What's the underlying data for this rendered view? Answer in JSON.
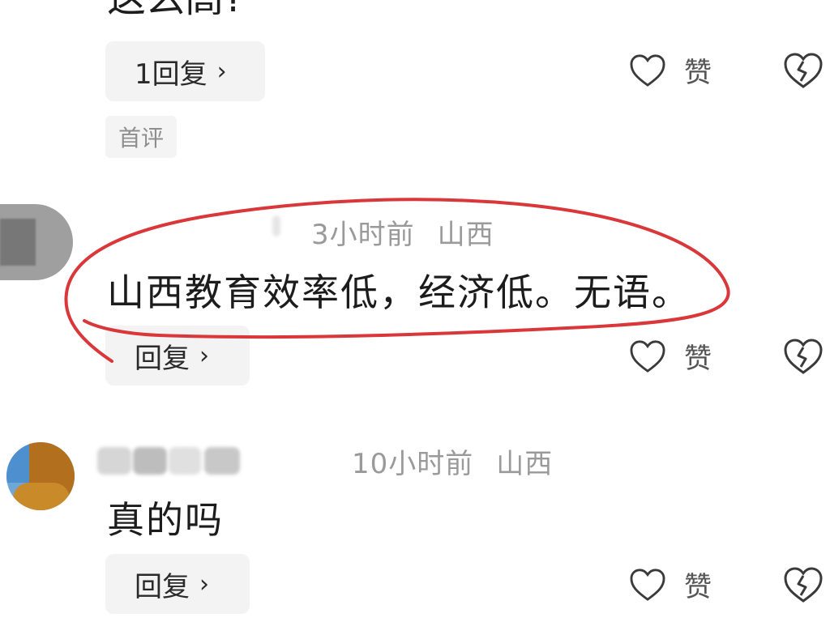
{
  "top_comment": {
    "text_fragment": "这么高?",
    "reply_button": "1回复",
    "like_label": "赞",
    "badge": "首评"
  },
  "comments": [
    {
      "time": "3小时前",
      "location": "山西",
      "text": "山西教育效率低，经济低。无语。",
      "reply_button": "回复",
      "like_label": "赞"
    },
    {
      "time": "10小时前",
      "location": "山西",
      "text": "真的吗",
      "reply_button": "回复",
      "like_label": "赞"
    }
  ],
  "icons": {
    "chevron": "chevron-right-icon",
    "like": "heart-outline-icon",
    "dislike": "broken-heart-icon"
  },
  "colors": {
    "annotation": "#d9373a",
    "meta_text": "#9a9a9a",
    "pill_bg": "#f3f3f3"
  }
}
